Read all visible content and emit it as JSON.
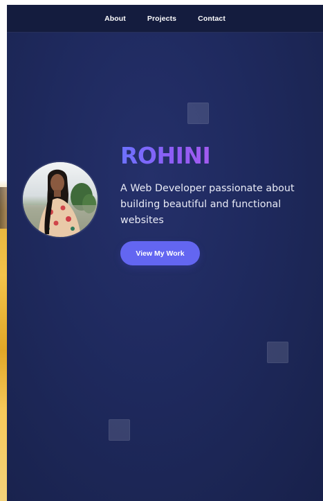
{
  "nav": {
    "items": [
      {
        "label": "About"
      },
      {
        "label": "Projects"
      },
      {
        "label": "Contact"
      }
    ]
  },
  "hero": {
    "name": "ROHINI",
    "tagline": "A Web Developer passionate about building beautiful and functional websites",
    "cta_label": "View My Work",
    "avatar_icon": "profile-photo"
  },
  "colors": {
    "background": "#1f2a5f",
    "nav_background": "#141c3e",
    "accent": "#6366f1",
    "name_gradient_start": "#6c72ff",
    "name_gradient_end": "#a35bf0"
  }
}
